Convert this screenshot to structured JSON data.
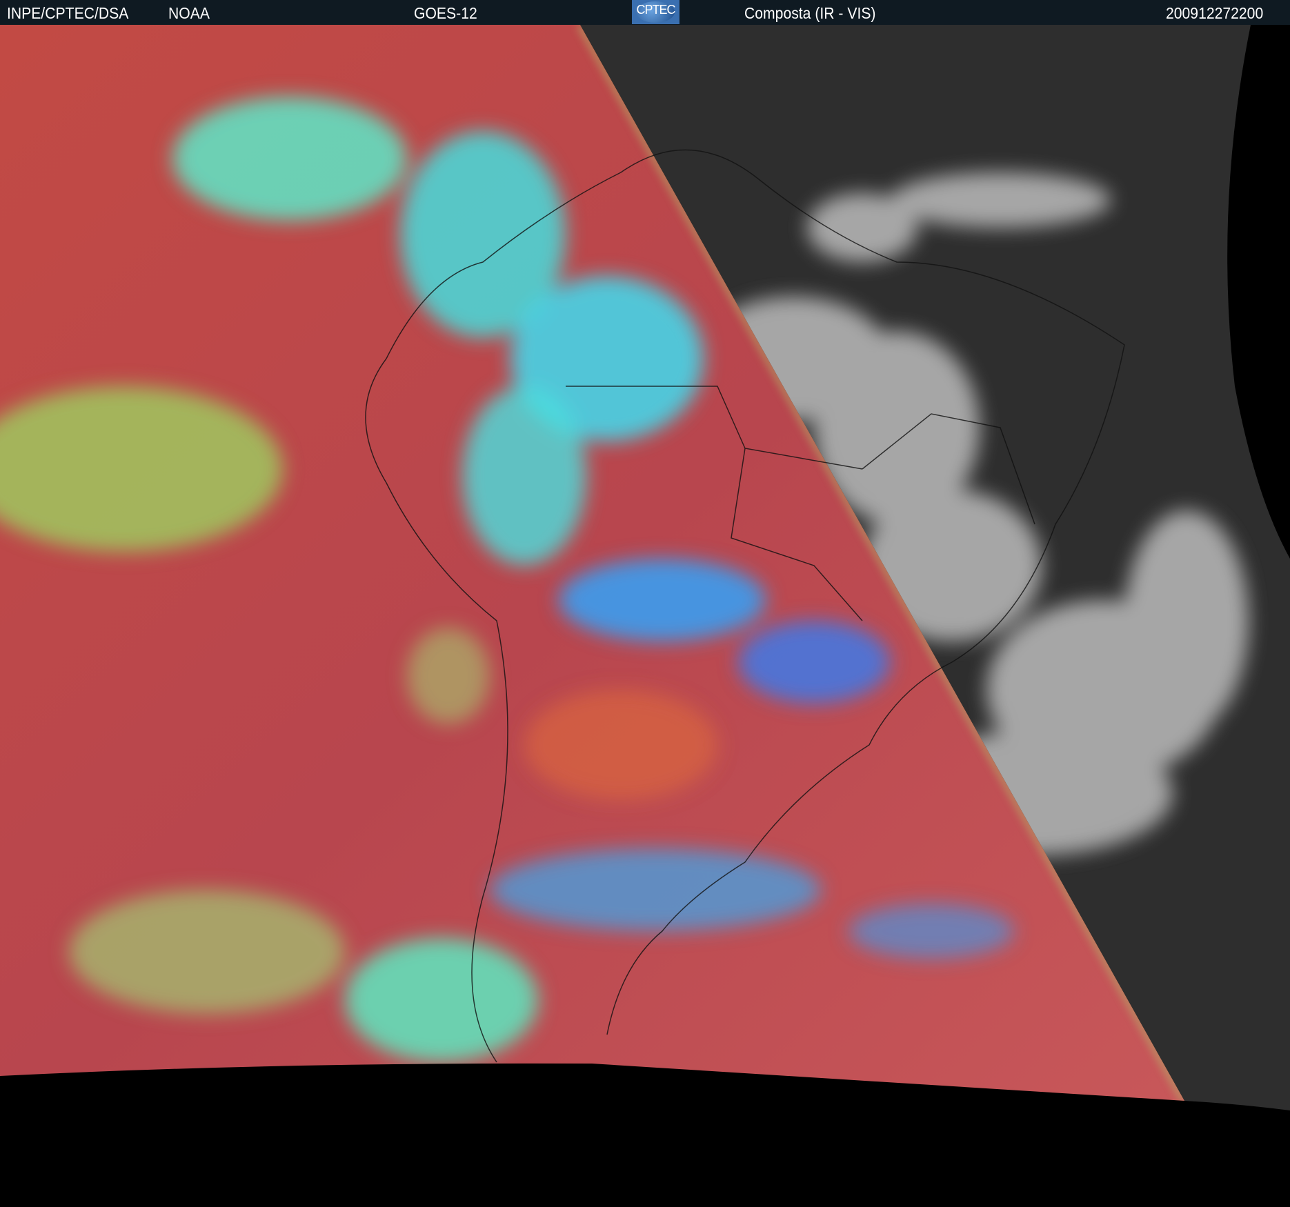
{
  "header": {
    "agency": "INPE/CPTEC/DSA",
    "source": "NOAA",
    "satellite": "GOES-12",
    "logo_text": "CPTEC",
    "product": "Composta (IR - VIS)",
    "timestamp": "200912272200"
  },
  "colors": {
    "header_bg": "#0f1a22",
    "ir_base": "#c0504a",
    "ir_cloud_cyan": "#3ee6e6",
    "ir_cloud_green": "#9ee06a",
    "ir_cloud_blue": "#3a9cf0",
    "vis_base": "#2e2e2e",
    "vis_cloud": "#d8d8d8",
    "space": "#000000"
  }
}
